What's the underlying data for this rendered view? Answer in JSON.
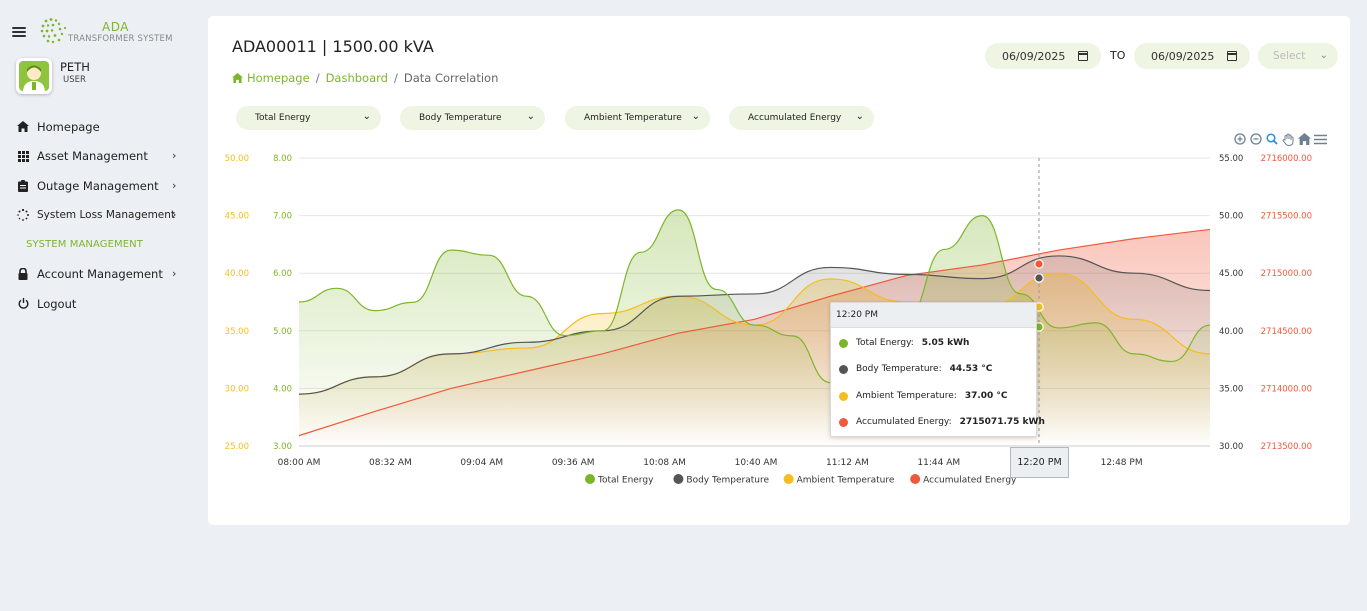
{
  "app": {
    "brand": "ADA",
    "brand_sub": "TRANSFORMER SYSTEM"
  },
  "user": {
    "name": "PETH",
    "role": "USER"
  },
  "nav": {
    "items": [
      {
        "label": "Homepage",
        "icon": "home-icon"
      },
      {
        "label": "Asset Management",
        "icon": "grid-icon",
        "chevron": "›"
      },
      {
        "label": "Outage Management",
        "icon": "clipboard-icon",
        "chevron": "›"
      },
      {
        "label": "System Loss Management",
        "icon": "spinner-icon",
        "chevron": "›"
      },
      {
        "label": "SYSTEM MANAGEMENT"
      },
      {
        "label": "Account Management",
        "icon": "lock-icon",
        "chevron": "›"
      },
      {
        "label": "Logout",
        "icon": "power-icon"
      }
    ]
  },
  "header": {
    "title": "ADA00011 | 1500.00 kVA",
    "breadcrumb": [
      "Homepage",
      "Dashboard",
      "Data Correlation"
    ],
    "sep": "/",
    "date_from": "06/09/2025",
    "to_label": "TO",
    "date_to": "06/09/2025",
    "select_placeholder": "Select"
  },
  "filters": [
    "Total Energy",
    "Body Temperature",
    "Ambient Temperature",
    "Accumulated Energy"
  ],
  "colors": {
    "green": "#7db52a",
    "gray": "#555555",
    "yellow": "#f5bd1f",
    "red": "#f05a3c"
  },
  "toolbar_icons": [
    "zoom-in-icon",
    "zoom-out-icon",
    "magnifier-icon",
    "pan-hand-icon",
    "reset-home-icon",
    "menu-icon"
  ],
  "chart_data": {
    "type": "area",
    "x": [
      "08:00 AM",
      "08:32 AM",
      "09:04 AM",
      "09:36 AM",
      "10:08 AM",
      "10:40 AM",
      "11:12 AM",
      "11:44 AM",
      "12:20 PM",
      "12:48 PM"
    ],
    "axes": {
      "total_energy": {
        "ticks": [
          "3.00",
          "4.00",
          "5.00",
          "6.00",
          "7.00",
          "8.00"
        ],
        "range": [
          3,
          8
        ]
      },
      "ambient_temperature": {
        "ticks": [
          "25.00",
          "30.00",
          "35.00",
          "40.00",
          "45.00",
          "50.00"
        ],
        "range": [
          25,
          50
        ]
      },
      "body_temperature": {
        "ticks": [
          "30.00",
          "35.00",
          "40.00",
          "45.00",
          "50.00",
          "55.00"
        ],
        "range": [
          30,
          55
        ]
      },
      "accumulated_energy": {
        "ticks": [
          "2713500.00",
          "2714000.00",
          "2714500.00",
          "2715000.00",
          "2715500.00",
          "2716000.00"
        ],
        "range": [
          2713500,
          2716000
        ]
      }
    },
    "series": [
      {
        "name": "Total Energy",
        "unit": "kWh",
        "values": [
          5.5,
          5.35,
          6.4,
          5.6,
          5.0,
          7.1,
          5.1,
          4.1,
          5.2,
          7.0,
          5.05,
          4.6,
          5.1
        ]
      },
      {
        "name": "Body Temperature",
        "unit": "°C",
        "values": [
          34.5,
          36.0,
          38.0,
          39.0,
          40.0,
          43.0,
          43.2,
          45.5,
          44.9,
          44.53,
          46.5,
          45.0,
          43.5
        ]
      },
      {
        "name": "Ambient Temperature",
        "unit": "°C",
        "values": [
          29.5,
          31.0,
          33.0,
          33.5,
          36.5,
          38.0,
          35.5,
          39.5,
          37.5,
          37.0,
          40.0,
          36.0,
          33.0
        ]
      },
      {
        "name": "Accumulated Energy",
        "unit": "kWh",
        "values": [
          2713590,
          2713800,
          2714000,
          2714150,
          2714300,
          2714480,
          2714600,
          2714800,
          2714980,
          2715071.75,
          2715200,
          2715300,
          2715380
        ]
      }
    ],
    "legend_position": "bottom",
    "grid": true,
    "tooltip": {
      "header": "12:20 PM",
      "rows": [
        {
          "label": "Total Energy:",
          "value": "5.05 kWh"
        },
        {
          "label": "Body Temperature:",
          "value": "44.53 °C"
        },
        {
          "label": "Ambient Temperature:",
          "value": "37.00 °C"
        },
        {
          "label": "Accumulated Energy:",
          "value": "2715071.75 kWh"
        }
      ]
    },
    "crosshair_label": "12:20 PM"
  }
}
